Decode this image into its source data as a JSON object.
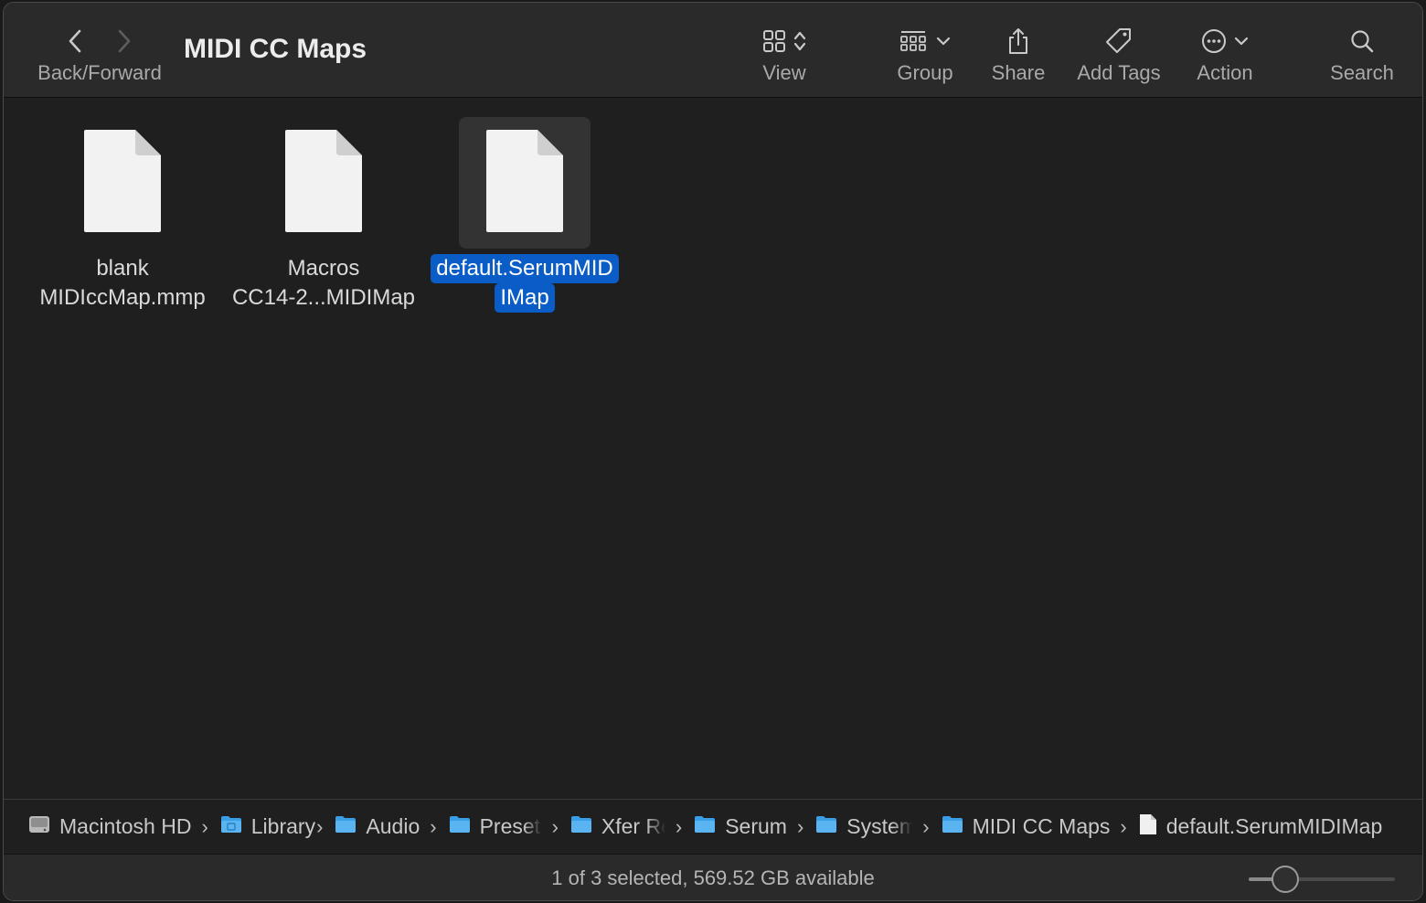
{
  "window": {
    "title": "MIDI CC Maps"
  },
  "toolbar": {
    "back_forward_label": "Back/Forward",
    "view_label": "View",
    "group_label": "Group",
    "share_label": "Share",
    "add_tags_label": "Add Tags",
    "action_label": "Action",
    "search_label": "Search"
  },
  "files": [
    {
      "line1": "blank",
      "line2": "MIDIccMap.mmp",
      "selected": false
    },
    {
      "line1": "Macros",
      "line2": "CC14-2...MIDIMap",
      "selected": false
    },
    {
      "line1": "default.SerumMID",
      "line2": "IMap",
      "selected": true
    }
  ],
  "pathbar": {
    "items": [
      {
        "label": "Macintosh HD",
        "icon": "hard-drive-icon"
      },
      {
        "label": "Library",
        "icon": "library-folder-icon"
      },
      {
        "label": "Audio",
        "icon": "folder-icon"
      },
      {
        "label": "Presets",
        "icon": "folder-icon"
      },
      {
        "label": "Xfer Records",
        "icon": "folder-icon"
      },
      {
        "label": "Serum",
        "icon": "folder-icon"
      },
      {
        "label": "System",
        "icon": "folder-icon"
      },
      {
        "label": "MIDI CC Maps",
        "icon": "folder-icon"
      },
      {
        "label": "default.SerumMIDIMap",
        "icon": "document-icon"
      }
    ]
  },
  "status": {
    "text": "1 of 3 selected, 569.52 GB available",
    "icon_size_level": 0.25
  },
  "colors": {
    "selection": "#0a5dc6",
    "background": "#1f1f1f",
    "toolbar": "#2a2a2a"
  }
}
